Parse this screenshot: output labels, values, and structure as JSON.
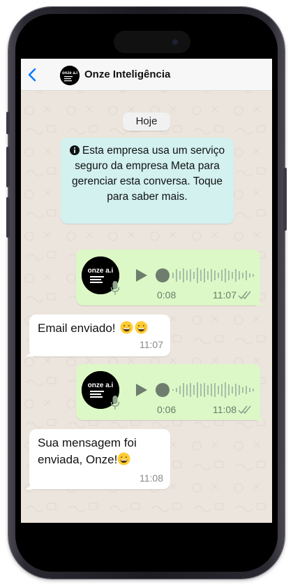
{
  "header": {
    "back_icon": "chevron-left-icon",
    "contact_name": "Onze Inteligência",
    "avatar_brand": "onze a.i"
  },
  "chat": {
    "date_label": "Hoje",
    "system_notice": "Esta empresa usa um serviço seguro da empresa Meta para gerenciar esta conversa. Toque para saber mais.",
    "messages": [
      {
        "type": "voice",
        "direction": "outgoing",
        "duration": "0:08",
        "time": "11:07",
        "status": "read"
      },
      {
        "type": "text",
        "direction": "incoming",
        "text": "Email enviado!",
        "emoji": "😄😄",
        "time": "11:07"
      },
      {
        "type": "voice",
        "direction": "outgoing",
        "duration": "0:06",
        "time": "11:08",
        "status": "read"
      },
      {
        "type": "text",
        "direction": "incoming",
        "text_line1": "Sua mensagem foi",
        "text_line2": "enviada, Onze!",
        "emoji": "😄",
        "time": "11:08"
      }
    ]
  },
  "colors": {
    "accent": "#0a7cff",
    "outgoing_bubble": "#dcf8c6",
    "incoming_bubble": "#ffffff",
    "system_bubble": "#d2f1ef",
    "chat_background": "#ece5dd"
  }
}
